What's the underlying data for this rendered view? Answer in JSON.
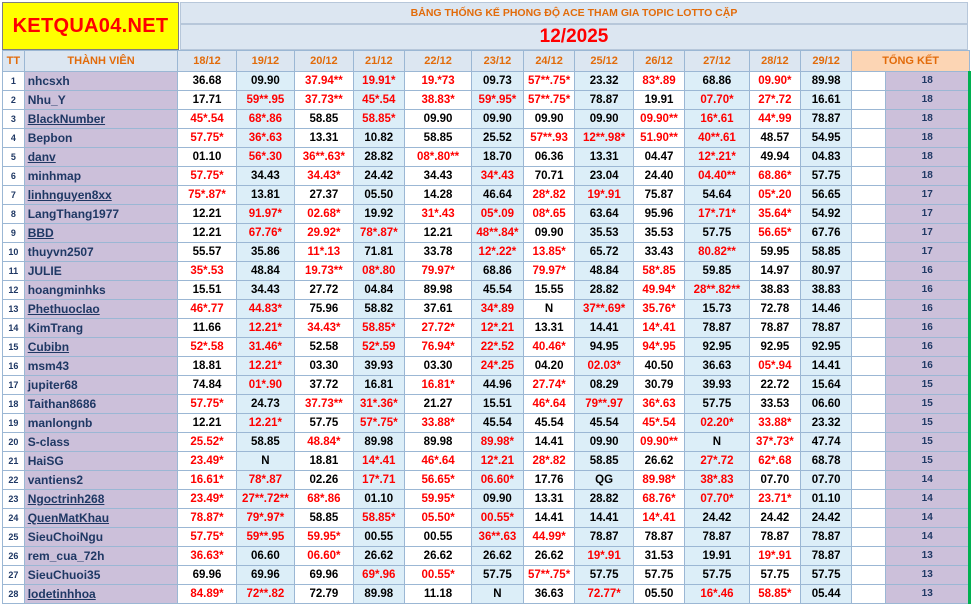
{
  "logo": "KETQUA04.NET",
  "title": "BẢNG THỐNG KỂ PHONG ĐỘ ACE THAM GIA TOPIC  LOTTO CẶP",
  "month": "12/2025",
  "headers": {
    "tt": "TT",
    "member": "THÀNH VIÊN",
    "total": "TỔNG KẾT"
  },
  "dates": [
    "18/12",
    "19/12",
    "20/12",
    "21/12",
    "22/12",
    "23/12",
    "24/12",
    "25/12",
    "26/12",
    "27/12",
    "28/12",
    "29/12"
  ],
  "rows": [
    {
      "tt": "1",
      "name": "nhcsxh",
      "u": false,
      "vals": [
        "36.68",
        "09.90",
        "37.94**",
        "19.91*",
        "19.*73",
        "09.73",
        "57**.75*",
        "23.32",
        "83*.89",
        "68.86",
        "09.90*",
        "89.98"
      ],
      "total": "18"
    },
    {
      "tt": "2",
      "name": "Nhu_Y",
      "u": false,
      "vals": [
        "17.71",
        "59**.95",
        "37.73**",
        "45*.54",
        "38.83*",
        "59*.95*",
        "57**.75*",
        "78.87",
        "19.91",
        "07.70*",
        "27*.72",
        "16.61"
      ],
      "total": "18"
    },
    {
      "tt": "3",
      "name": "BlackNumber",
      "u": true,
      "vals": [
        "45*.54",
        "68*.86",
        "58.85",
        "58.85*",
        "09.90",
        "09.90",
        "09.90",
        "09.90",
        "09.90**",
        "16*.61",
        "44*.99",
        "78.87"
      ],
      "total": "18"
    },
    {
      "tt": "4",
      "name": "Bepbon",
      "u": false,
      "vals": [
        "57.75*",
        "36*.63",
        "13.31",
        "10.82",
        "58.85",
        "25.52",
        "57**.93",
        "12**.98*",
        "51.90**",
        "40**.61",
        "48.57",
        "54.95"
      ],
      "total": "18"
    },
    {
      "tt": "5",
      "name": "danv",
      "u": true,
      "vals": [
        "01.10",
        "56*.30",
        "36**.63*",
        "28.82",
        "08*.80**",
        "18.70",
        "06.36",
        "13.31",
        "04.47",
        "12*.21*",
        "49.94",
        "04.83"
      ],
      "total": "18"
    },
    {
      "tt": "6",
      "name": "minhmap",
      "u": false,
      "vals": [
        "57.75*",
        "34.43",
        "34.43*",
        "24.42",
        "34.43",
        "34*.43",
        "70.71",
        "23.04",
        "24.40",
        "04.40**",
        "68.86*",
        "57.75"
      ],
      "total": "18"
    },
    {
      "tt": "7",
      "name": "linhnguyen8xx",
      "u": true,
      "vals": [
        "75*.87*",
        "13.81",
        "27.37",
        "05.50",
        "14.28",
        "46.64",
        "28*.82",
        "19*.91",
        "75.87",
        "54.64",
        "05*.20",
        "56.65"
      ],
      "total": "17"
    },
    {
      "tt": "8",
      "name": "LangThang1977",
      "u": false,
      "vals": [
        "12.21",
        "91.97*",
        "02.68*",
        "19.92",
        "31*.43",
        "05*.09",
        "08*.65",
        "63.64",
        "95.96",
        "17*.71*",
        "35.64*",
        "54.92"
      ],
      "total": "17"
    },
    {
      "tt": "9",
      "name": "BBD",
      "u": true,
      "vals": [
        "12.21",
        "67.76*",
        "29.92*",
        "78*.87*",
        "12.21",
        "48**.84*",
        "09.90",
        "35.53",
        "35.53",
        "57.75",
        "56.65*",
        "67.76"
      ],
      "total": "17"
    },
    {
      "tt": "10",
      "name": "thuyvn2507",
      "u": false,
      "vals": [
        "55.57",
        "35.86",
        "11*.13",
        "71.81",
        "33.78",
        "12*.22*",
        "13.85*",
        "65.72",
        "33.43",
        "80.82**",
        "59.95",
        "58.85"
      ],
      "total": "17"
    },
    {
      "tt": "11",
      "name": "JULIE",
      "u": false,
      "vals": [
        "35*.53",
        "48.84",
        "19.73**",
        "08*.80",
        "79.97*",
        "68.86",
        "79.97*",
        "48.84",
        "58*.85",
        "59.85",
        "14.97",
        "80.97"
      ],
      "total": "16"
    },
    {
      "tt": "12",
      "name": "hoangminhks",
      "u": false,
      "vals": [
        "15.51",
        "34.43",
        "27.72",
        "04.84",
        "89.98",
        "45.54",
        "15.55",
        "28.82",
        "49.94*",
        "28**.82**",
        "38.83",
        "38.83"
      ],
      "total": "16"
    },
    {
      "tt": "13",
      "name": "Phethuoclao",
      "u": true,
      "vals": [
        "46*.77",
        "44.83*",
        "75.96",
        "58.82",
        "37.61",
        "34*.89",
        "N",
        "37**.69*",
        "35.76*",
        "15.73",
        "72.78",
        "14.46"
      ],
      "total": "16"
    },
    {
      "tt": "14",
      "name": "KimTrang",
      "u": false,
      "vals": [
        "11.66",
        "12.21*",
        "34.43*",
        "58.85*",
        "27.72*",
        "12*.21",
        "13.31",
        "14.41",
        "14*.41",
        "78.87",
        "78.87",
        "78.87"
      ],
      "total": "16"
    },
    {
      "tt": "15",
      "name": "Cubibn",
      "u": true,
      "vals": [
        "52*.58",
        "31.46*",
        "52.58",
        "52*.59",
        "76.94*",
        "22*.52",
        "40.46*",
        "94.95",
        "94*.95",
        "92.95",
        "92.95",
        "92.95"
      ],
      "total": "16"
    },
    {
      "tt": "16",
      "name": "msm43",
      "u": false,
      "vals": [
        "18.81",
        "12.21*",
        "03.30",
        "39.93",
        "03.30",
        "24*.25",
        "04.20",
        "02.03*",
        "40.50",
        "36.63",
        "05*.94",
        "14.41"
      ],
      "total": "16"
    },
    {
      "tt": "17",
      "name": "jupiter68",
      "u": false,
      "vals": [
        "74.84",
        "01*.90",
        "37.72",
        "16.81",
        "16.81*",
        "44.96",
        "27.74*",
        "08.29",
        "30.79",
        "39.93",
        "22.72",
        "15.64"
      ],
      "total": "15"
    },
    {
      "tt": "18",
      "name": "Taithan8686",
      "u": false,
      "vals": [
        "57.75*",
        "24.73",
        "37.73**",
        "31*.36*",
        "21.27",
        "15.51",
        "46*.64",
        "79**.97",
        "36*.63",
        "57.75",
        "33.53",
        "06.60"
      ],
      "total": "15"
    },
    {
      "tt": "19",
      "name": "manlongnb",
      "u": false,
      "vals": [
        "12.21",
        "12.21*",
        "57.75",
        "57*.75*",
        "33.88*",
        "45.54",
        "45.54",
        "45.54",
        "45*.54",
        "02.20*",
        "33.88*",
        "23.32"
      ],
      "total": "15"
    },
    {
      "tt": "20",
      "name": "S-class",
      "u": false,
      "vals": [
        "25.52*",
        "58.85",
        "48.84*",
        "89.98",
        "89.98",
        "89.98*",
        "14.41",
        "09.90",
        "09.90**",
        "N",
        "37*.73*",
        "47.74"
      ],
      "total": "15"
    },
    {
      "tt": "21",
      "name": "HaiSG",
      "u": false,
      "vals": [
        "23.49*",
        "N",
        "18.81",
        "14*.41",
        "46*.64",
        "12*.21",
        "28*.82",
        "58.85",
        "26.62",
        "27*.72",
        "62*.68",
        "68.78"
      ],
      "total": "15"
    },
    {
      "tt": "22",
      "name": "vantiens2",
      "u": false,
      "vals": [
        "16.61*",
        "78*.87",
        "02.26",
        "17*.71",
        "56.65*",
        "06.60*",
        "17.76",
        "QG",
        "89.98*",
        "38*.83",
        "07.70",
        "07.70"
      ],
      "total": "14"
    },
    {
      "tt": "23",
      "name": "Ngoctrinh268",
      "u": true,
      "vals": [
        "23.49*",
        "27**.72**",
        "68*.86",
        "01.10",
        "59.95*",
        "09.90",
        "13.31",
        "28.82",
        "68.76*",
        "07.70*",
        "23.71*",
        "01.10"
      ],
      "total": "14"
    },
    {
      "tt": "24",
      "name": "QuenMatKhau",
      "u": true,
      "vals": [
        "78.87*",
        "79*.97*",
        "58.85",
        "58.85*",
        "05.50*",
        "00.55*",
        "14.41",
        "14.41",
        "14*.41",
        "24.42",
        "24.42",
        "24.42"
      ],
      "total": "14"
    },
    {
      "tt": "25",
      "name": "SieuChoiNgu",
      "u": false,
      "vals": [
        "57.75*",
        "59**.95",
        "59.95*",
        "00.55",
        "00.55",
        "36**.63",
        "44.99*",
        "78.87",
        "78.87",
        "78.87",
        "78.87",
        "78.87"
      ],
      "total": "14"
    },
    {
      "tt": "26",
      "name": "rem_cua_72h",
      "u": false,
      "vals": [
        "36.63*",
        "06.60",
        "06.60*",
        "26.62",
        "26.62",
        "26.62",
        "26.62",
        "19*.91",
        "31.53",
        "19.91",
        "19*.91",
        "78.87"
      ],
      "total": "13"
    },
    {
      "tt": "27",
      "name": "SieuChuoi35",
      "u": false,
      "vals": [
        "69.96",
        "69.96",
        "69.96",
        "69*.96",
        "00.55*",
        "57.75",
        "57**.75*",
        "57.75",
        "57.75",
        "57.75",
        "57.75",
        "57.75"
      ],
      "total": "13"
    },
    {
      "tt": "28",
      "name": "lodetinhhoa",
      "u": true,
      "vals": [
        "84.89*",
        "72**.82",
        "72.79",
        "89.98",
        "11.18",
        "N",
        "36.63",
        "72.77*",
        "05.50",
        "16*.46",
        "58.85*",
        "05.44"
      ],
      "total": "13"
    }
  ],
  "colors": {
    "logo_bg": "#ffff00",
    "logo_text": "#ff0000",
    "header_bg": "#dce6f1",
    "title_text": "#e26b0a",
    "month_text": "#ff0000",
    "name_bg": "#ccc0da",
    "alt_col_bg": "#dceef8",
    "total_header_bg": "#fcd5b4",
    "hit_text": "#ff0000",
    "border_green": "#00b050"
  }
}
